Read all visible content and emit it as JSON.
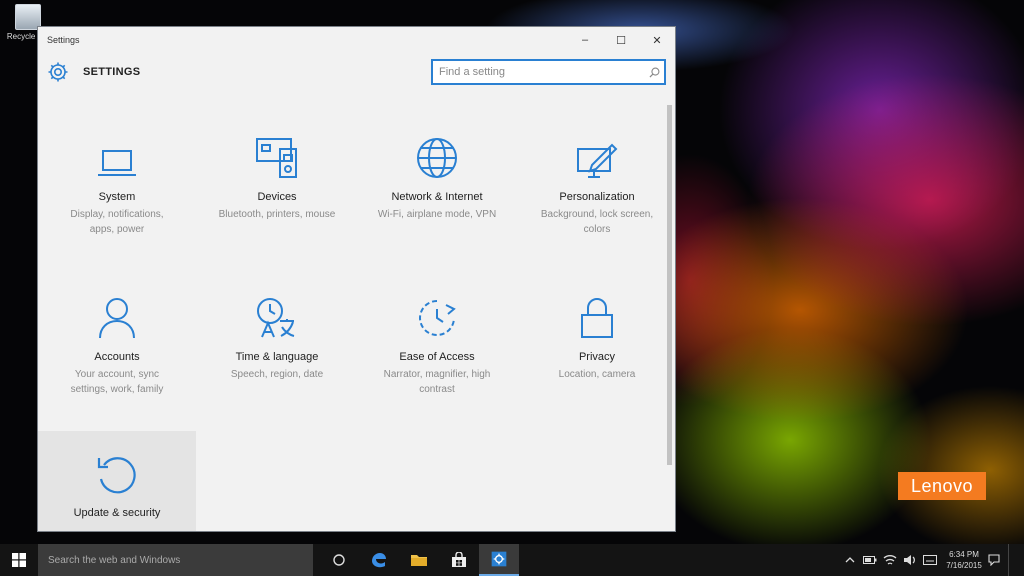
{
  "desktop": {
    "recycle_bin_label": "Recycle Bin",
    "brand_logo": "Lenovo"
  },
  "window": {
    "title": "Settings",
    "minimize": "–",
    "maximize": "☐",
    "close": "✕"
  },
  "header": {
    "title": "SETTINGS",
    "search_placeholder": "Find a setting"
  },
  "categories": [
    {
      "name": "System",
      "desc": "Display, notifications, apps, power",
      "icon": "laptop-icon"
    },
    {
      "name": "Devices",
      "desc": "Bluetooth, printers, mouse",
      "icon": "devices-icon"
    },
    {
      "name": "Network & Internet",
      "desc": "Wi-Fi, airplane mode, VPN",
      "icon": "globe-icon"
    },
    {
      "name": "Personalization",
      "desc": "Background, lock screen, colors",
      "icon": "paint-icon"
    },
    {
      "name": "Accounts",
      "desc": "Your account, sync settings, work, family",
      "icon": "person-icon"
    },
    {
      "name": "Time & language",
      "desc": "Speech, region, date",
      "icon": "time-language-icon"
    },
    {
      "name": "Ease of Access",
      "desc": "Narrator, magnifier, high contrast",
      "icon": "ease-of-access-icon"
    },
    {
      "name": "Privacy",
      "desc": "Location, camera",
      "icon": "lock-icon"
    },
    {
      "name": "Update & security",
      "desc": "",
      "icon": "update-icon"
    }
  ],
  "taskbar": {
    "search_placeholder": "Search the web and Windows",
    "clock_time": "6:34 PM",
    "clock_date": "7/16/2015"
  },
  "colors": {
    "accent": "#2a80d2",
    "brand": "#f47b20"
  }
}
